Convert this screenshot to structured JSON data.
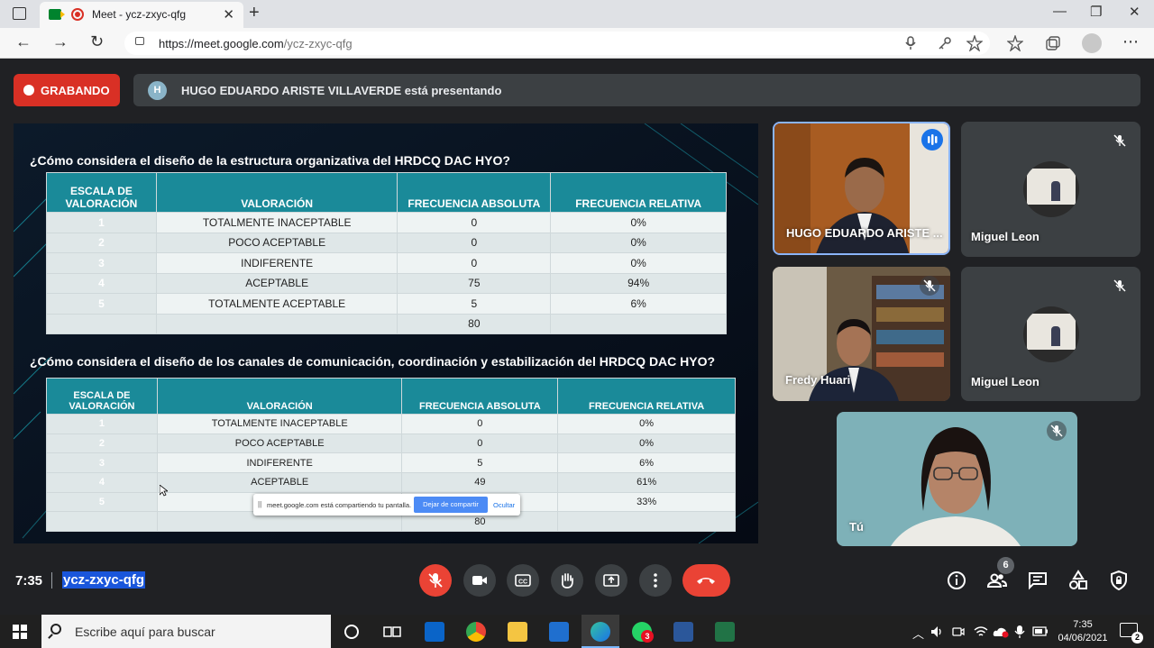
{
  "browser": {
    "tab_title": "Meet - ycz-zxyc-qfg",
    "url_host": "https://meet.google.com",
    "url_path": "/ycz-zxyc-qfg",
    "new_tab": "+",
    "tab_close": "✕",
    "minimize": "—",
    "maximize": "❐",
    "close": "✕",
    "back": "←",
    "forward": "→",
    "reload": "↻",
    "menu": "⋯"
  },
  "meet": {
    "recording_label": "GRABANDO",
    "presenter_initial": "H",
    "presenter_text": "HUGO EDUARDO ARISTE VILLAVERDE está presentando",
    "time": "7:35",
    "meeting_code": "ycz-zxyc-qfg",
    "participants_count": "6"
  },
  "slide": {
    "question1": "¿Cómo considera el diseño de la estructura organizativa del HRDCQ DAC HYO?",
    "question2": "¿Cómo considera el diseño de los canales de comunicación, coordinación y estabilización del HRDCQ DAC HYO?",
    "headers": [
      "ESCALA DE VALORACIÓN",
      "VALORACIÓN",
      "FRECUENCIA ABSOLUTA",
      "FRECUENCIA RELATIVA"
    ],
    "table1": [
      [
        "1",
        "TOTALMENTE INACEPTABLE",
        "0",
        "0%"
      ],
      [
        "2",
        "POCO ACEPTABLE",
        "0",
        "0%"
      ],
      [
        "3",
        "INDIFERENTE",
        "0",
        "0%"
      ],
      [
        "4",
        "ACEPTABLE",
        "75",
        "94%"
      ],
      [
        "5",
        "TOTALMENTE ACEPTABLE",
        "5",
        "6%"
      ],
      [
        "",
        "",
        "80",
        ""
      ]
    ],
    "table2": [
      [
        "1",
        "TOTALMENTE INACEPTABLE",
        "0",
        "0%"
      ],
      [
        "2",
        "POCO ACEPTABLE",
        "0",
        "0%"
      ],
      [
        "3",
        "INDIFERENTE",
        "5",
        "6%"
      ],
      [
        "4",
        "ACEPTABLE",
        "49",
        "61%"
      ],
      [
        "5",
        "TOTAL",
        "",
        "33%"
      ],
      [
        "",
        "",
        "80",
        ""
      ]
    ]
  },
  "share_bar": {
    "grip": "||",
    "message": "meet.google.com está compartiendo tu pantalla.",
    "stop_label": "Dejar de compartir",
    "hide_label": "Ocultar"
  },
  "participants": [
    {
      "name": "HUGO EDUARDO ARISTE ..."
    },
    {
      "name": "Miguel Leon"
    },
    {
      "name": "Fredy Huari"
    },
    {
      "name": "Miguel Leon"
    },
    {
      "name": "Tú"
    }
  ],
  "taskbar": {
    "search_placeholder": "Escribe aquí para buscar",
    "clock_time": "7:35",
    "clock_date": "04/06/2021",
    "whatsapp_badge": "3",
    "notifications": "2"
  },
  "colors": {
    "record_red": "#d93025",
    "hangup_red": "#ea4335",
    "table_teal": "#1a8a99",
    "meet_bg": "#202124"
  }
}
